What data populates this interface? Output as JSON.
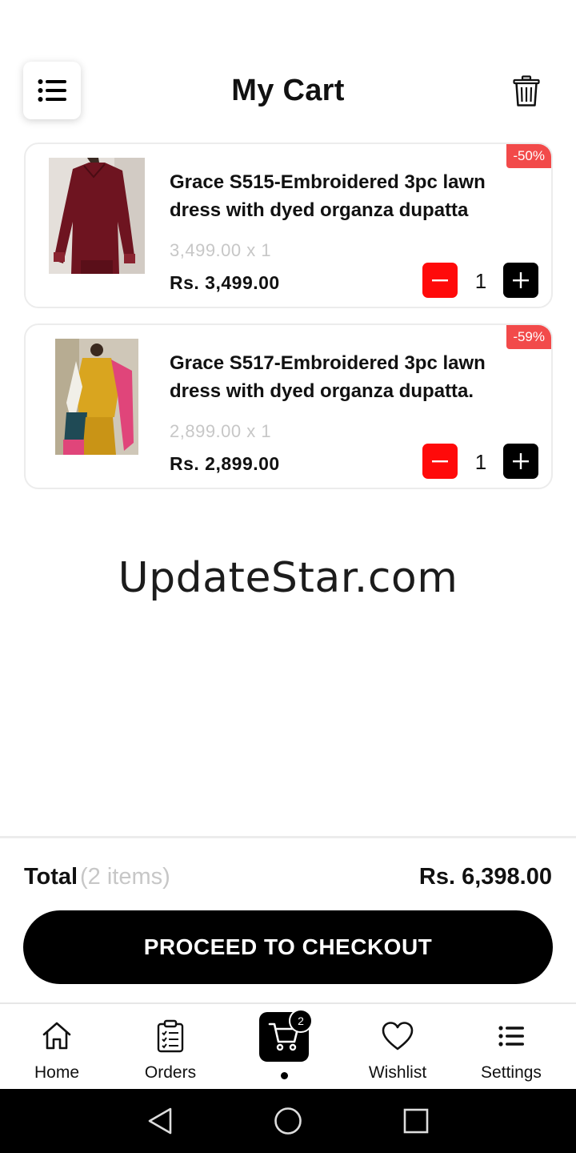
{
  "header": {
    "title": "My Cart",
    "menu_icon": "list-icon",
    "trash_icon": "trash-icon"
  },
  "cart": {
    "items": [
      {
        "discount": "-50%",
        "name": "Grace S515-Embroidered 3pc lawn dress with dyed organza dupatta",
        "unit_price": "3,499.00 x 1",
        "line_price": "Rs. 3,499.00",
        "quantity": "1",
        "image_colors": [
          "#6e1420",
          "#8a2430",
          "#d9d2cc"
        ]
      },
      {
        "discount": "-59%",
        "name": "Grace S517-Embroidered 3pc lawn dress with dyed organza dupatta.",
        "unit_price": "2,899.00 x 1",
        "line_price": "Rs. 2,899.00",
        "quantity": "1",
        "image_colors": [
          "#d9a51f",
          "#1f4a55",
          "#e0457a"
        ]
      }
    ]
  },
  "watermark": "UpdateStar.com",
  "summary": {
    "total_label": "Total",
    "item_count": "(2 items)",
    "total_amount": "Rs. 6,398.00",
    "checkout_label": "PROCEED TO CHECKOUT"
  },
  "bottom_nav": {
    "items": [
      {
        "label": "Home",
        "icon": "home-icon"
      },
      {
        "label": "Orders",
        "icon": "clipboard-icon"
      },
      {
        "label": "",
        "icon": "cart-icon",
        "badge": "2",
        "active": true
      },
      {
        "label": "Wishlist",
        "icon": "heart-icon"
      },
      {
        "label": "Settings",
        "icon": "list-icon"
      }
    ]
  },
  "colors": {
    "accent_red": "#ff0a0a",
    "badge_red": "#f24a4a",
    "primary_black": "#000000",
    "muted_text": "#c7c7c7"
  }
}
